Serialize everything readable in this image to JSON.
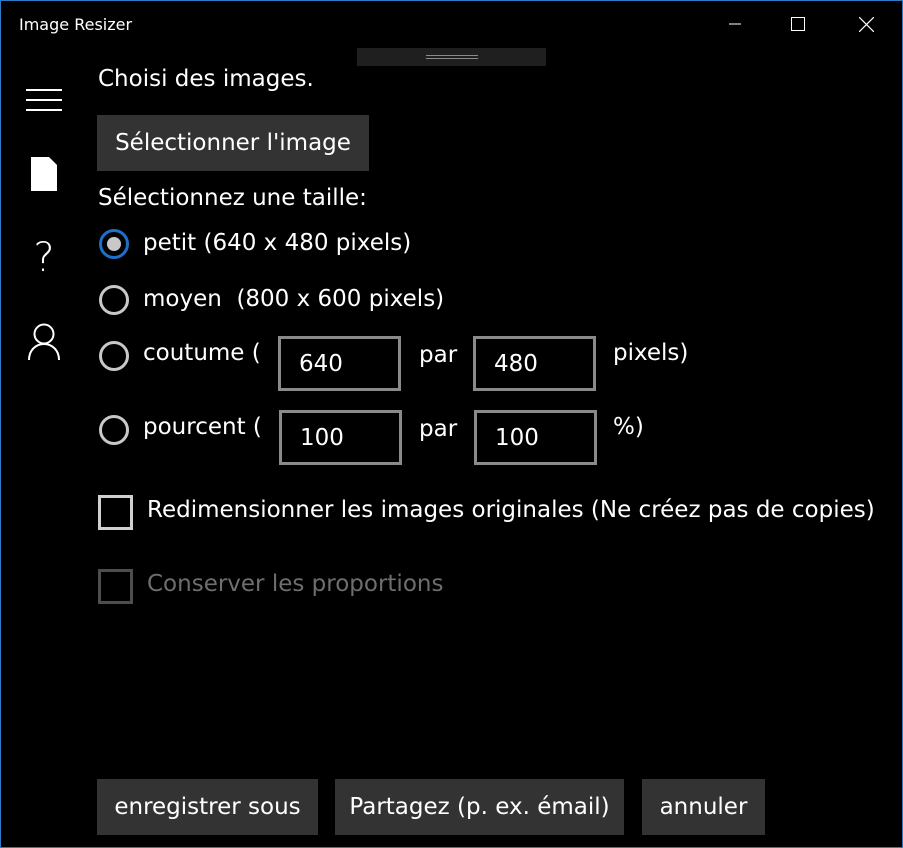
{
  "window": {
    "title": "Image Resizer",
    "accent_color": "#2b79c7",
    "controls": [
      "minimize-icon",
      "maximize-icon",
      "close-icon"
    ]
  },
  "nav": {
    "items": [
      "menu-icon",
      "document-icon",
      "help-icon",
      "user-icon"
    ],
    "help_glyph": "?"
  },
  "main": {
    "choose_heading": "Choisi des images.",
    "select_image_label": "Sélectionner l'image",
    "size_heading": "Sélectionnez une taille:",
    "options": {
      "small": "petit (640 x 480 pixels)",
      "medium": "moyen  (800 x 600 pixels)",
      "custom_prefix": "coutume (",
      "custom_sep": "par",
      "custom_suffix": "pixels)",
      "custom_width": "640",
      "custom_height": "480",
      "percent_prefix": "pourcent (",
      "percent_sep": "par",
      "percent_suffix": "%)",
      "percent_width": "100",
      "percent_height": "100"
    },
    "selected_option": "small",
    "resize_originals_label": "Redimensionner les images originales (Ne créez pas de copies)",
    "resize_originals_checked": false,
    "keep_proportions_label": "Conserver les proportions",
    "keep_proportions_checked": false,
    "keep_proportions_enabled": false
  },
  "footer": {
    "save_as": "enregistrer sous",
    "share": "Partagez (p. ex. émail)",
    "cancel": "annuler"
  },
  "colors": {
    "background": "#000000",
    "button": "#333333",
    "radio_selected": "#1e6fc8",
    "disabled_text": "#6e6e6e"
  }
}
